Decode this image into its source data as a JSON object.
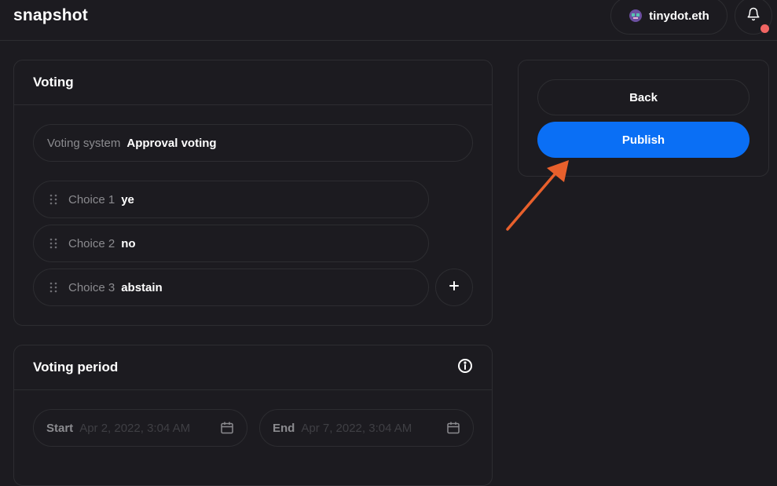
{
  "header": {
    "logo": "snapshot",
    "account_name": "tinydot.eth"
  },
  "voting": {
    "title": "Voting",
    "system_label": "Voting system",
    "system_value": "Approval voting",
    "choices": [
      {
        "label": "Choice 1",
        "value": "ye"
      },
      {
        "label": "Choice 2",
        "value": "no"
      },
      {
        "label": "Choice 3",
        "value": "abstain"
      }
    ]
  },
  "voting_period": {
    "title": "Voting period",
    "start_label": "Start",
    "start_placeholder": "Apr 2, 2022, 3:04 AM",
    "end_label": "End",
    "end_placeholder": "Apr 7, 2022, 3:04 AM"
  },
  "actions": {
    "back_label": "Back",
    "publish_label": "Publish"
  },
  "colors": {
    "background": "#1c1b20",
    "border": "#2d2d31",
    "primary": "#0a6ff5",
    "notification": "#f16563",
    "annotation_arrow": "#e8602c"
  },
  "icons": [
    "avatar-icon",
    "bell-icon",
    "drag-handle-icon",
    "plus-icon",
    "info-icon",
    "calendar-icon",
    "annotation-arrow"
  ]
}
